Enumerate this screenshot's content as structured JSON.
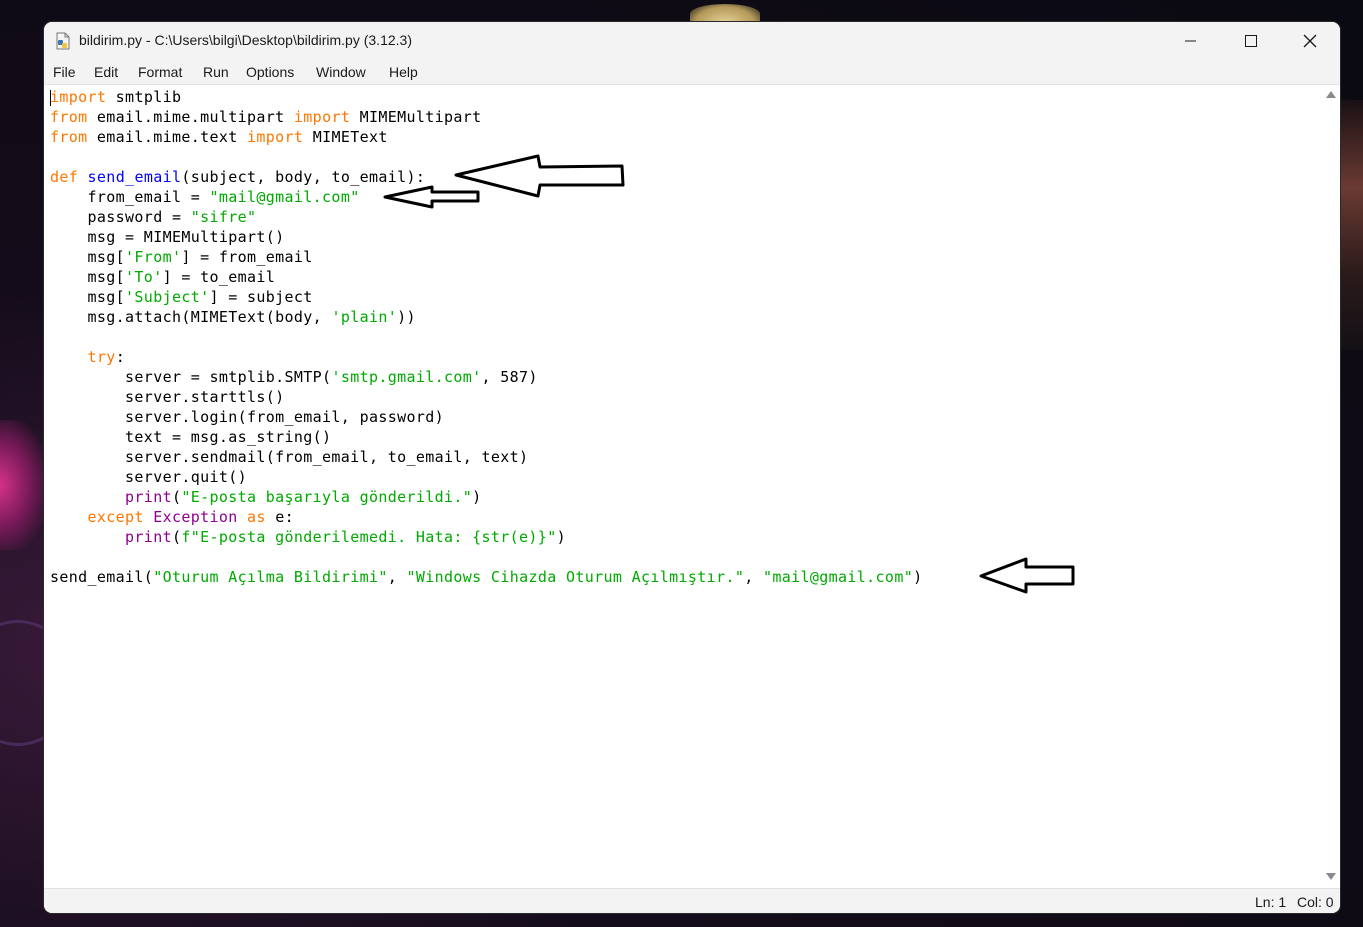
{
  "window": {
    "title": "bildirim.py - C:\\Users\\bilgi\\Desktop\\bildirim.py (3.12.3)",
    "app_icon": "python-file-icon",
    "controls": [
      "minimize-icon",
      "maximize-icon",
      "close-icon"
    ]
  },
  "menu": {
    "items": [
      "File",
      "Edit",
      "Format",
      "Run",
      "Options",
      "Window",
      "Help"
    ]
  },
  "editor": {
    "code": {
      "l1": {
        "kw": "import",
        "t": " smtplib"
      },
      "l2": {
        "kw1": "from",
        "t1": " email.mime.multipart ",
        "kw2": "import",
        "t2": " MIMEMultipart"
      },
      "l3": {
        "kw1": "from",
        "t1": " email.mime.text ",
        "kw2": "import",
        "t2": " MIMEText"
      },
      "l5": {
        "kw": "def",
        "t1": " ",
        "fn": "send_email",
        "t2": "(subject, body, to_email):"
      },
      "l6": {
        "t": "    from_email = ",
        "s": "\"mail@gmail.com\""
      },
      "l7": {
        "t": "    password = ",
        "s": "\"sifre\""
      },
      "l8": {
        "t": "    msg = MIMEMultipart()"
      },
      "l9": {
        "t1": "    msg[",
        "s": "'From'",
        "t2": "] = from_email"
      },
      "l10": {
        "t1": "    msg[",
        "s": "'To'",
        "t2": "] = to_email"
      },
      "l11": {
        "t1": "    msg[",
        "s": "'Subject'",
        "t2": "] = subject"
      },
      "l12": {
        "t1": "    msg.attach(MIMEText(body, ",
        "s": "'plain'",
        "t2": "))"
      },
      "l14": {
        "t": "    ",
        "kw": "try",
        "t2": ":"
      },
      "l15": {
        "t1": "        server = smtplib.SMTP(",
        "s": "'smtp.gmail.com'",
        "t2": ", 587)"
      },
      "l16": {
        "t": "        server.starttls()"
      },
      "l17": {
        "t": "        server.login(from_email, password)"
      },
      "l18": {
        "t": "        text = msg.as_string()"
      },
      "l19": {
        "t": "        server.sendmail(from_email, to_email, text)"
      },
      "l20": {
        "t": "        server.quit()"
      },
      "l21": {
        "t1": "        ",
        "bi": "print",
        "t2": "(",
        "s": "\"E-posta başarıyla gönderildi.\"",
        "t3": ")"
      },
      "l22": {
        "t1": "    ",
        "kw1": "except",
        "t2": " ",
        "bi": "Exception",
        "t3": " ",
        "kw2": "as",
        "t4": " e:"
      },
      "l23": {
        "t1": "        ",
        "bi": "print",
        "t2": "(",
        "s": "f\"E-posta gönderilemedi. Hata: {str(e)}\"",
        "t3": ")"
      },
      "l25": {
        "t1": "send_email(",
        "s1": "\"Oturum Açılma Bildirimi\"",
        "t2": ", ",
        "s2": "\"Windows Cihazda Oturum Açılmıştır.\"",
        "t3": ", ",
        "s3": "\"mail@gmail.com\"",
        "t4": ")"
      }
    }
  },
  "annotations": [
    "arrow-icon",
    "arrow-icon",
    "arrow-icon"
  ],
  "status": {
    "line": "Ln: 1",
    "col": "Col: 0"
  },
  "colors": {
    "keyword": "#ff7700",
    "string": "#00aa00",
    "definition": "#0000ff",
    "builtin": "#900090"
  }
}
